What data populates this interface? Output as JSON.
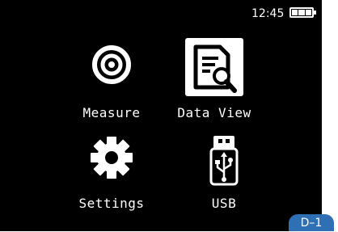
{
  "status_bar": {
    "time": "12:45",
    "battery_icon": "battery-full-icon",
    "battery_level": 1.0
  },
  "menu": [
    {
      "label": "Measure",
      "icon": "target-icon"
    },
    {
      "label": "Data View",
      "icon": "document-search-icon"
    },
    {
      "label": "Settings",
      "icon": "gear-icon"
    },
    {
      "label": "USB",
      "icon": "usb-drive-icon"
    }
  ],
  "figure_label": "D–1",
  "colors": {
    "screen_background": "#000000",
    "foreground": "#ffffff",
    "badge": "#2f6fb3"
  }
}
